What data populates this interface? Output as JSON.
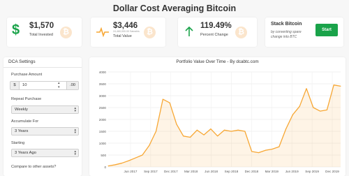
{
  "page_title": "Dollar Cost Averaging Bitcoin",
  "cards": {
    "invested": {
      "value": "$1,570",
      "label": "Total Invested",
      "icon": "dollar-icon"
    },
    "value": {
      "value": "$3,446",
      "btc": "24,460,000.00 Satoshis",
      "label": "Total Value",
      "icon": "pulse-icon"
    },
    "change": {
      "value": "119.49%",
      "label": "Percent Change",
      "icon": "arrow-up-icon"
    },
    "stack": {
      "title": "Stack Bitcoin",
      "desc_line1": "by converting spare",
      "desc_line2": "change into BTC",
      "button": "Start"
    }
  },
  "coin_symbol": "₿",
  "settings": {
    "header": "DCA Settings",
    "purchase_amount_label": "Purchase Amount",
    "currency_prefix": "$",
    "amount_value": "10",
    "cents_suffix": ".00",
    "repeat_label": "Repeat Purchase",
    "repeat_value": "Weekly",
    "accumulate_label": "Accumulate For",
    "accumulate_value": "3 Years",
    "starting_label": "Starting",
    "starting_value": "3 Years Ago",
    "compare_label": "Compare to other assets?"
  },
  "colors": {
    "accent": "#f7a734",
    "green": "#1aa34a",
    "coin": "#fbe5cc"
  },
  "chart_data": {
    "type": "area",
    "title": "Portfolio Value Over Time - By dcabtc.com",
    "x_tick_labels": [
      "Jun 2017",
      "Sep 2017",
      "Dec 2017",
      "Mar 2018",
      "Jun 2018",
      "Sep 2018",
      "Dec 2018",
      "Mar 2019",
      "Jun 2019",
      "Sep 2019",
      "Dec 2019"
    ],
    "y_ticks": [
      0,
      500,
      1000,
      1500,
      2000,
      2500,
      3000,
      3500,
      4000
    ],
    "ylim": [
      0,
      4000
    ],
    "x_index_range": [
      0,
      34
    ],
    "grid": true,
    "series": [
      {
        "x": [
          0,
          1,
          2,
          3,
          4,
          5,
          6,
          7,
          8,
          9,
          10,
          11,
          12,
          13,
          14,
          15,
          16,
          17,
          18,
          19,
          20,
          21,
          22,
          23,
          24,
          25,
          26,
          27,
          28,
          29,
          30,
          31,
          32,
          33,
          34
        ],
        "values": [
          40,
          90,
          160,
          260,
          380,
          500,
          900,
          1500,
          2850,
          2700,
          1800,
          1300,
          1250,
          1550,
          1350,
          1600,
          1300,
          1550,
          1500,
          1550,
          1500,
          650,
          600,
          700,
          750,
          850,
          1600,
          2200,
          2550,
          3300,
          2500,
          2350,
          2400,
          3450,
          3400
        ]
      }
    ]
  }
}
